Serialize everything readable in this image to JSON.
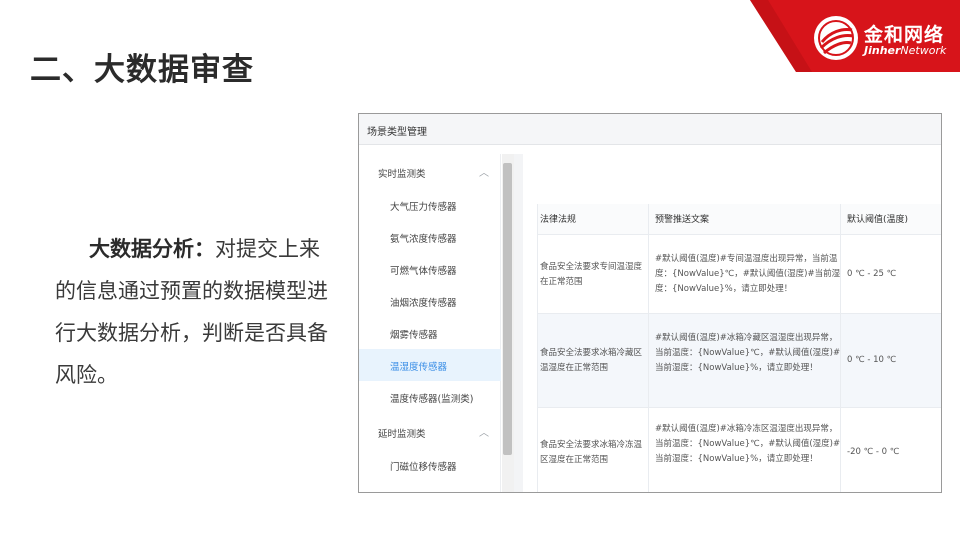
{
  "slide": {
    "title": "二、大数据审查",
    "lead_title": "大数据分析：",
    "lead_body": "对提交上来的信息通过预置的数据模型进行大数据分析，判断是否具备风险。"
  },
  "brand": {
    "name_cn": "金和网络",
    "name_en_bold": "Jinher",
    "name_en_light": "Network",
    "color": "#d7141a",
    "logo_icon": "jinher-globe-icon"
  },
  "app": {
    "window_title": "场景类型管理",
    "sidebar": {
      "groups": [
        {
          "label": "实时监测类",
          "icon": "chevron-up-icon",
          "items": [
            {
              "label": "大气压力传感器"
            },
            {
              "label": "氨气浓度传感器"
            },
            {
              "label": "可燃气体传感器"
            },
            {
              "label": "油烟浓度传感器"
            },
            {
              "label": "烟雾传感器"
            },
            {
              "label": "温湿度传感器",
              "active": true
            },
            {
              "label": "温度传感器(监测类)"
            }
          ]
        },
        {
          "label": "延时监测类",
          "icon": "chevron-up-icon",
          "items": [
            {
              "label": "门磁位移传感器"
            }
          ]
        }
      ]
    },
    "table": {
      "columns": [
        "法律法规",
        "预警推送文案",
        "默认阈值(温度)"
      ],
      "rows": [
        {
          "law": "食品安全法要求专间温湿度在正常范围",
          "message": "#默认阈值(温度)#专间温湿度出现异常，当前温度：{NowValue}℃，#默认阈值(湿度)#当前湿度：{NowValue}%，请立即处理！",
          "threshold": "0 ℃ - 25 ℃"
        },
        {
          "law": "食品安全法要求冰箱冷藏区温湿度在正常范围",
          "message": "#默认阈值(温度)#冰箱冷藏区温湿度出现异常，当前温度：{NowValue}℃，#默认阈值(湿度)#当前湿度：{NowValue}%，请立即处理！",
          "threshold": "0 ℃ - 10 ℃"
        },
        {
          "law": "食品安全法要求冰箱冷冻温区湿度在正常范围",
          "message": "#默认阈值(温度)#冰箱冷冻区温湿度出现异常，当前温度：{NowValue}℃，#默认阈值(湿度)#当前湿度：{NowValue}%，请立即处理！",
          "threshold": "-20 ℃ - 0 ℃"
        }
      ]
    }
  }
}
